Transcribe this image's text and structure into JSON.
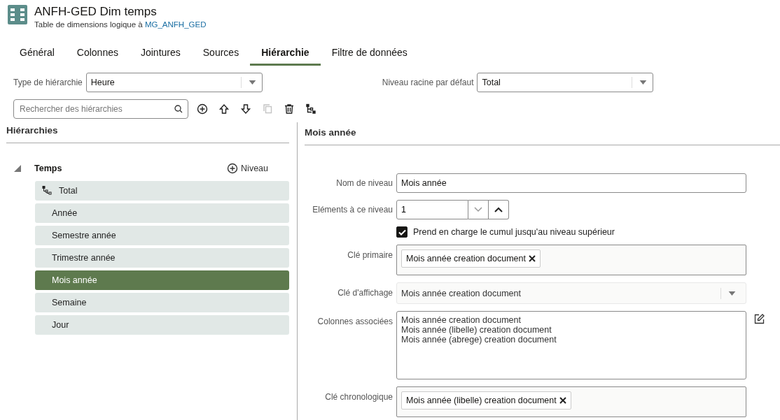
{
  "header": {
    "title": "ANFH-GED Dim temps",
    "subtitle_prefix": "Table de dimensions logique à",
    "subtitle_link": "MG_ANFH_GED"
  },
  "tabs": [
    {
      "label": "Général",
      "selected": false
    },
    {
      "label": "Colonnes",
      "selected": false
    },
    {
      "label": "Jointures",
      "selected": false
    },
    {
      "label": "Sources",
      "selected": false
    },
    {
      "label": "Hiérarchie",
      "selected": true
    },
    {
      "label": "Filtre de données",
      "selected": false
    }
  ],
  "hierarchy_type": {
    "label": "Type de hiérarchie",
    "value": "Heure"
  },
  "default_root": {
    "label": "Niveau racine par défaut",
    "value": "Total"
  },
  "search": {
    "placeholder": "Rechercher des hiérarchies"
  },
  "toolbar": [
    {
      "kind": "add",
      "disabled": false
    },
    {
      "kind": "up",
      "disabled": false
    },
    {
      "kind": "down",
      "disabled": false
    },
    {
      "kind": "copy",
      "disabled": true
    },
    {
      "kind": "delete",
      "disabled": false
    },
    {
      "kind": "tree",
      "disabled": false
    }
  ],
  "hierarchies": {
    "title": "Hiérarchies",
    "tree": {
      "label": "Temps",
      "expanded": true,
      "add_label": "Niveau",
      "children": [
        {
          "label": "Total",
          "kind": "root",
          "selected": false
        },
        {
          "label": "Année",
          "kind": "level",
          "selected": false
        },
        {
          "label": "Semestre année",
          "kind": "level",
          "selected": false
        },
        {
          "label": "Trimestre année",
          "kind": "level",
          "selected": false
        },
        {
          "label": "Mois année",
          "kind": "level",
          "selected": true
        },
        {
          "label": "Semaine",
          "kind": "level",
          "selected": false
        },
        {
          "label": "Jour",
          "kind": "level",
          "selected": false
        }
      ]
    }
  },
  "detail": {
    "title": "Mois année",
    "level_name": {
      "label": "Nom de niveau",
      "value": "Mois année"
    },
    "elements": {
      "label": "Eléments à ce niveau",
      "value": "1",
      "down_disabled": true
    },
    "rollup": {
      "label": "Prend en charge le cumul jusqu'au niveau supérieur",
      "checked": true
    },
    "primary_key": {
      "label": "Clé primaire",
      "tags": [
        "Mois année creation document"
      ]
    },
    "display_key": {
      "label": "Clé d'affichage",
      "value": "Mois année creation document"
    },
    "associated_columns": {
      "label": "Colonnes associées",
      "lines": [
        "Mois année creation document",
        "Mois année (libelle) creation document",
        "Mois année (abrege) creation document"
      ]
    },
    "chrono_key": {
      "label": "Clé chronologique",
      "tags": [
        "Mois année (libelle) creation document"
      ]
    }
  }
}
